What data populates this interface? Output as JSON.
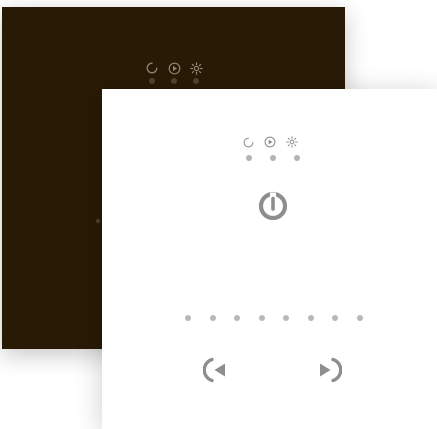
{
  "colors": {
    "back_panel_bg": "#291a05",
    "back_icon": "#8f8474",
    "back_dot": "#4f4331",
    "front_panel_bg": "#ffffff",
    "front_icon": "#8a8a8a",
    "front_dot": "#b3b3b3",
    "power_icon": "#8e8e8e",
    "page_dot": "#b8b8b8",
    "nav_icon": "#8e8e8e"
  },
  "back_panel": {
    "mode_icons": [
      "spinner-icon",
      "play-icon",
      "brightness-icon"
    ],
    "mode_dot_count": 3
  },
  "front_panel": {
    "mode_icons": [
      "spinner-icon",
      "play-icon",
      "brightness-icon"
    ],
    "mode_dot_count": 3,
    "power_icon": "power-icon",
    "page_dot_count": 8,
    "prev_icon": "prev-arrow-icon",
    "next_icon": "next-arrow-icon"
  }
}
